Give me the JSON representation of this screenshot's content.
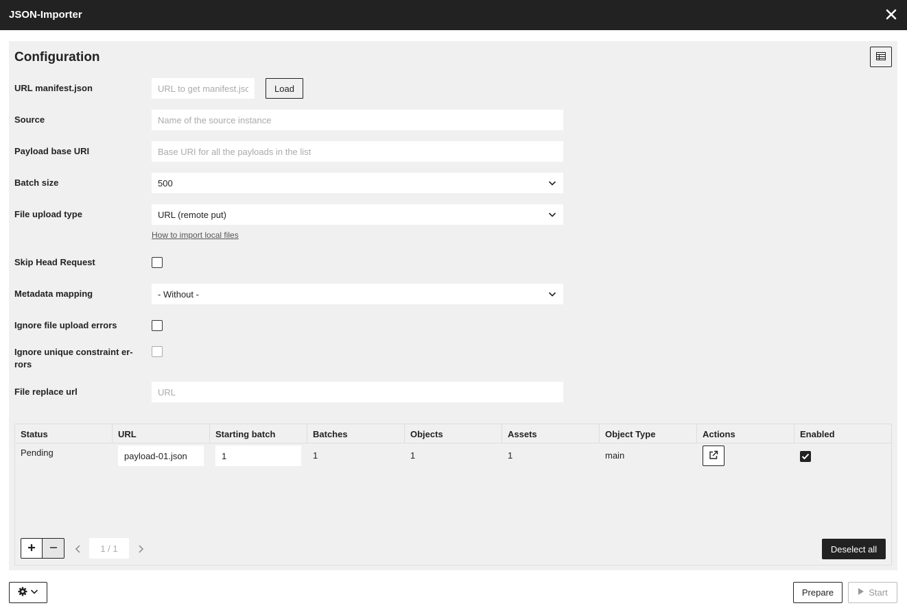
{
  "window": {
    "title": "JSON-Importer"
  },
  "config": {
    "title": "Configuration",
    "fields": {
      "manifest": {
        "label": "URL manifest.json",
        "placeholder": "URL to get manifest.jsc",
        "button": "Load"
      },
      "source": {
        "label": "Source",
        "placeholder": "Name of the source instance"
      },
      "payload_base": {
        "label": "Payload base URI",
        "placeholder": "Base URI for all the payloads in the list"
      },
      "batch_size": {
        "label": "Batch size",
        "value": "500"
      },
      "file_upload": {
        "label": "File upload type",
        "value": "URL (remote put)",
        "link": "How to import local files"
      },
      "skip_head": {
        "label": "Skip Head Request",
        "checked": false
      },
      "metadata_mapping": {
        "label": "Metadata mapping",
        "value": "- Without -"
      },
      "ignore_upload_errors": {
        "label": "Ignore file upload errors",
        "checked": false
      },
      "ignore_unique": {
        "label_line1": "Ignore unique constraint er-",
        "label_line2": "rors",
        "checked": false,
        "disabled": true
      },
      "file_replace": {
        "label": "File replace url",
        "placeholder": "URL"
      }
    }
  },
  "grid": {
    "columns": [
      "Status",
      "URL",
      "Starting batch",
      "Batches",
      "Objects",
      "Assets",
      "Object Type",
      "Actions",
      "Enabled"
    ],
    "rows": [
      {
        "status": "Pending",
        "url": "payload-01.json",
        "starting_batch": "1",
        "batches": "1",
        "objects": "1",
        "assets": "1",
        "object_type": "main",
        "enabled": true
      }
    ],
    "pager": "1 / 1",
    "deselect_label": "Deselect all"
  },
  "footer": {
    "prepare_label": "Prepare",
    "start_label": "Start"
  },
  "icons": [
    "close-icon",
    "table-icon",
    "chevron-down-icon",
    "external-link-icon",
    "check-icon",
    "plus-icon",
    "minus-icon",
    "chevron-left-icon",
    "chevron-right-icon",
    "gear-icon",
    "play-icon"
  ]
}
